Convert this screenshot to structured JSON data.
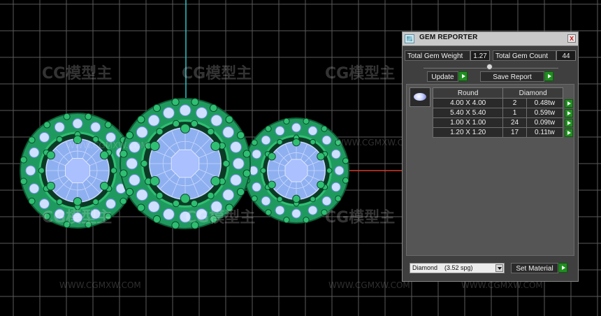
{
  "viewport": {
    "watermark_logo": "CG模型主",
    "watermark_url": "WWW.CGMXW.COM"
  },
  "gem_reporter": {
    "title": "GEM REPORTER",
    "close_label": "x",
    "total_gem_weight_label": "Total Gem Weight",
    "total_gem_weight_value": "1.27",
    "total_gem_count_label": "Total Gem Count",
    "total_gem_count_value": "44",
    "update_label": "Update",
    "save_report_label": "Save Report",
    "table": {
      "headers": [
        "Round",
        "Diamond"
      ],
      "rows": [
        {
          "size": "4.00 X 4.00",
          "count": "2",
          "weight": "0.48tw"
        },
        {
          "size": "5.40 X 5.40",
          "count": "1",
          "weight": "0.59tw"
        },
        {
          "size": "1.00 X 1.00",
          "count": "24",
          "weight": "0.09tw"
        },
        {
          "size": "1.20 X 1.20",
          "count": "17",
          "weight": "0.11tw"
        }
      ]
    },
    "material_selected": "Diamond    (3.52 spg)",
    "set_material_label": "Set Material"
  },
  "colors": {
    "metal": "#1f9a5e",
    "gem": "#8fb0f0",
    "grid": "#5a5a5a",
    "axis_cyan": "#31c3c6",
    "axis_red": "#d83a2a",
    "go_button": "#1f8f1f"
  },
  "icons": {
    "app": "gem-reporter-app-icon",
    "close": "close-icon",
    "go": "play-arrow-icon",
    "gem_preview": "diamond-gem-icon",
    "dropdown": "chevron-down-icon"
  }
}
